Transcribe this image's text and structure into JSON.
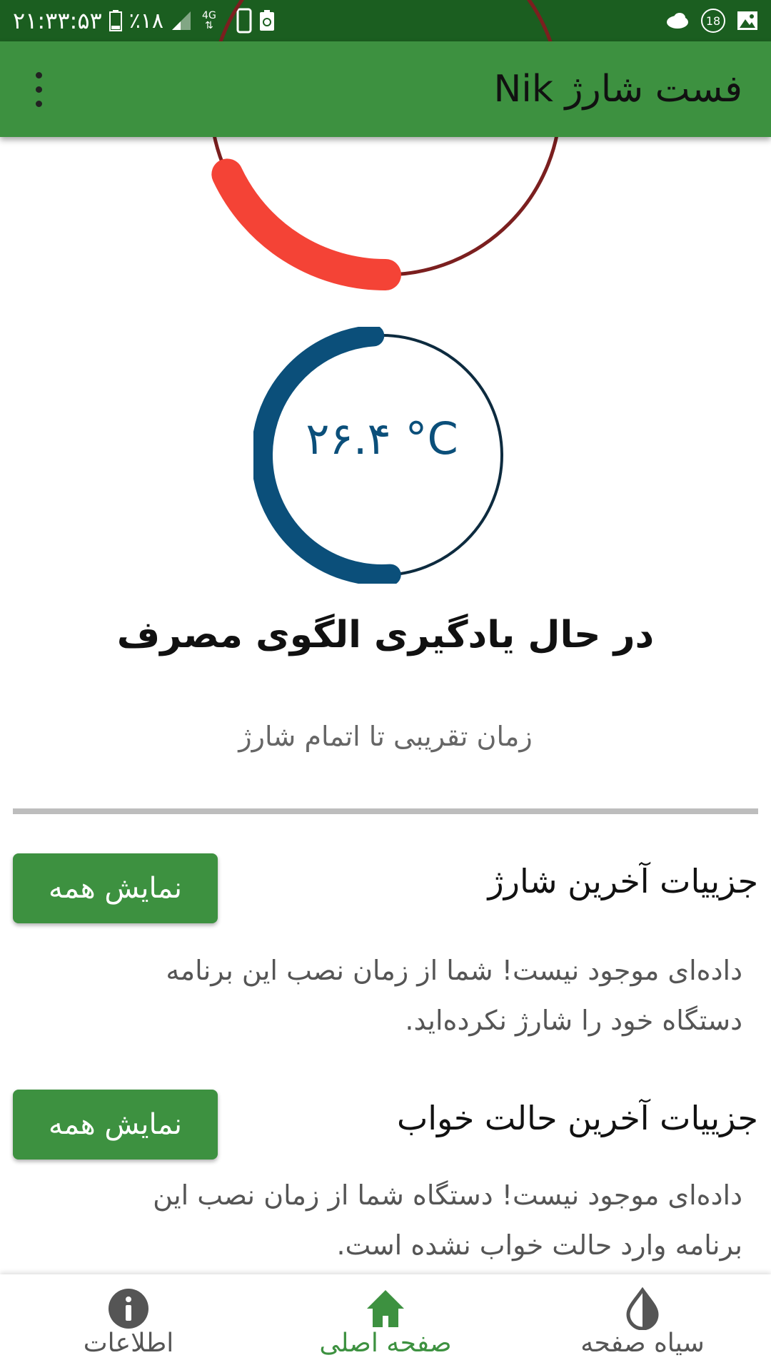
{
  "status_bar": {
    "time": "۲۱:۳۳:۵۳",
    "battery_percent": "٪۱۸",
    "network": "4G",
    "notification_count": "18"
  },
  "app_bar": {
    "title": "فست شارژ Nik"
  },
  "charge_gauge": {
    "level_fraction": 0.18,
    "fill_color": "#f44336",
    "track_color": "#7b1f1f"
  },
  "temperature_gauge": {
    "value_text": "۲۶.۴ °C",
    "fill_color": "#0b4f7a"
  },
  "status": {
    "learning_text": "در حال یادگیری الگوی مصرف",
    "eta_label": "زمان تقریبی تا اتمام شارژ"
  },
  "sections": {
    "last_charge": {
      "title": "جزییات آخرین شارژ",
      "button": "نمایش همه",
      "body_line1": "داده‌ای موجود نیست! شما از زمان نصب این برنامه",
      "body_line2": "دستگاه خود را شارژ نکرده‌اید."
    },
    "last_sleep": {
      "title": "جزییات آخرین حالت خواب",
      "button": "نمایش همه",
      "body_line1": "داده‌ای موجود نیست! دستگاه شما از زمان نصب این",
      "body_line2": "برنامه وارد حالت خواب نشده است."
    }
  },
  "bottom_nav": {
    "items": [
      {
        "label": "اطلاعات",
        "icon": "info-icon",
        "active": false
      },
      {
        "label": "صفحه اصلی",
        "icon": "home-icon",
        "active": true
      },
      {
        "label": "سیاه صفحه",
        "icon": "contrast-drop-icon",
        "active": false
      }
    ],
    "active_color": "#3d9140",
    "inactive_color": "#555555"
  }
}
